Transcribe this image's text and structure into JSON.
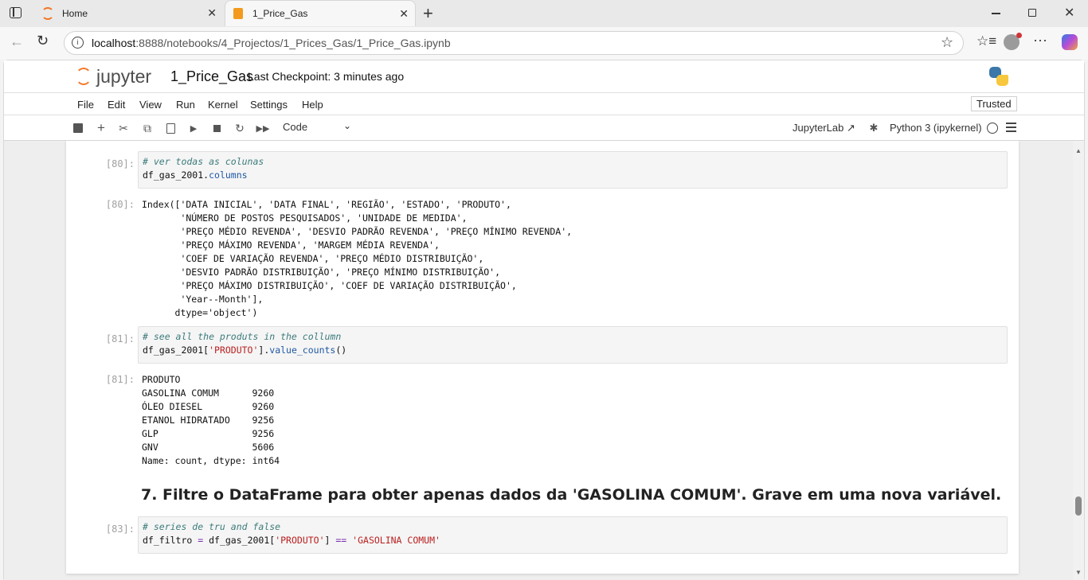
{
  "browser": {
    "tabs": [
      {
        "label": "Home",
        "icon": "jupyter-icon",
        "active": false
      },
      {
        "label": "1_Price_Gas",
        "icon": "notebook-icon",
        "active": true
      }
    ],
    "url_host": "localhost",
    "url_rest": ":8888/notebooks/4_Projectos/1_Prices_Gas/1_Price_Gas.ipynb"
  },
  "jupyter": {
    "logo_text": "jupyter",
    "notebook_title": "1_Price_Gas",
    "checkpoint": "Last Checkpoint: 3 minutes ago",
    "trusted": "Trusted",
    "menu": [
      "File",
      "Edit",
      "View",
      "Run",
      "Kernel",
      "Settings",
      "Help"
    ],
    "cell_type": "Code",
    "jupyterlab_link": "JupyterLab",
    "kernel": "Python 3 (ipykernel)"
  },
  "cells": {
    "c80": {
      "prompt": "[80]:",
      "comment": "# ver todas as colunas",
      "code_a": "df_gas_2001.",
      "code_b": "columns",
      "out_prompt": "[80]:",
      "output": "Index(['DATA INICIAL', 'DATA FINAL', 'REGIÃO', 'ESTADO', 'PRODUTO',\n       'NÚMERO DE POSTOS PESQUISADOS', 'UNIDADE DE MEDIDA',\n       'PREÇO MÉDIO REVENDA', 'DESVIO PADRÃO REVENDA', 'PREÇO MÍNIMO REVENDA',\n       'PREÇO MÁXIMO REVENDA', 'MARGEM MÉDIA REVENDA',\n       'COEF DE VARIAÇÃO REVENDA', 'PREÇO MÉDIO DISTRIBUIÇÃO',\n       'DESVIO PADRÃO DISTRIBUIÇÃO', 'PREÇO MÍNIMO DISTRIBUIÇÃO',\n       'PREÇO MÁXIMO DISTRIBUIÇÃO', 'COEF DE VARIAÇÃO DISTRIBUIÇÃO',\n       'Year--Month'],\n      dtype='object')"
    },
    "c81": {
      "prompt": "[81]:",
      "comment": "# see all the produts in the collumn",
      "code_a": "df_gas_2001[",
      "code_str": "'PRODUTO'",
      "code_b": "].",
      "code_c": "value_counts",
      "code_d": "()",
      "out_prompt": "[81]:",
      "output": "PRODUTO\nGASOLINA COMUM      9260\nÓLEO DIESEL         9260\nETANOL HIDRATADO    9256\nGLP                 9256\nGNV                 5606\nName: count, dtype: int64"
    },
    "md7": "7. Filtre o DataFrame para obter apenas dados da 'GASOLINA COMUM'. Grave em uma nova variável.",
    "c83": {
      "prompt": "[83]:",
      "comment": "# series de tru and false",
      "code_a": "df_filtro ",
      "code_eq": "=",
      "code_b": " df_gas_2001[",
      "code_str": "'PRODUTO'",
      "code_c": "] ",
      "code_op": "==",
      "code_d": " ",
      "code_str2": "'GASOLINA COMUM'"
    }
  }
}
